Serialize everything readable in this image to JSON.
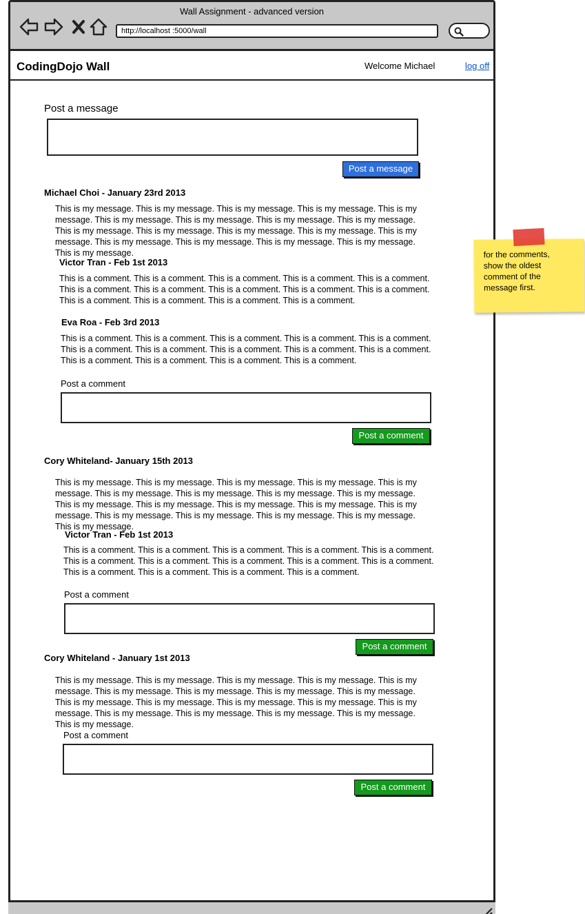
{
  "window": {
    "title": "Wall Assignment - advanced version",
    "url": "http://localhost :5000/wall",
    "icons": [
      "back-icon",
      "forward-icon",
      "close-icon",
      "home-icon",
      "search-icon"
    ]
  },
  "header": {
    "brand": "CodingDojo Wall",
    "welcome": "Welcome Michael",
    "logoff": "log off"
  },
  "post_form": {
    "label": "Post a message",
    "button": "Post a message"
  },
  "messages": [
    {
      "author": "Michael Choi - January 23rd 2013",
      "text": "This is my message. This is my message. This is my message. This is my message. This is my message. This is my message. This is my message. This is my message. This is my message. This is my message. This is my message. This is my message. This is my message. This is my message. This is my message. This is my message. This is my message. This is my message. This is my message.",
      "comments": [
        {
          "author": "Victor Tran - Feb 1st 2013",
          "text": "This is a comment. This is a comment. This is a comment. This is a comment. This is a comment. This is a comment. This is a comment. This is a comment. This is a comment. This is a comment. This is a comment. This is a comment. This is a comment. This is a comment."
        },
        {
          "author": "Eva Roa - Feb 3rd 2013",
          "text": "This is a comment. This is a comment. This is a comment. This is a comment. This is a comment. This is a comment. This is a comment. This is a comment. This is a comment. This is a comment. This is a comment. This is a comment. This is a comment. This is a comment."
        }
      ],
      "comment_label": "Post a comment",
      "comment_button": "Post a comment"
    },
    {
      "author": "Cory Whiteland- January 15th 2013",
      "text": "This is my message. This is my message. This is my message. This is my message. This is my message. This is my message. This is my message. This is my message. This is my message. This is my message. This is my message. This is my message. This is my message. This is my message. This is my message. This is my message. This is my message. This is my message. This is my message.",
      "comments": [
        {
          "author": "Victor Tran - Feb 1st 2013",
          "text": "This is a comment. This is a comment. This is a comment. This is a comment. This is a comment. This is a comment. This is a comment. This is a comment. This is a comment. This is a comment. This is a comment. This is a comment. This is a comment. This is a comment."
        }
      ],
      "comment_label": "Post a comment",
      "comment_button": "Post a comment"
    },
    {
      "author": "Cory Whiteland - January 1st 2013",
      "text": "This is my message. This is my message. This is my message. This is my message. This is my message. This is my message. This is my message. This is my message. This is my message. This is my message. This is my message. This is my message. This is my message. This is my message. This is my message. This is my message. This is my message. This is my message. This is my message.",
      "comments": [],
      "comment_label": "Post a comment",
      "comment_button": "Post a comment"
    }
  ],
  "sticky_note": {
    "text": "for the comments, show the oldest comment of the message first."
  },
  "colors": {
    "primary_button": "#2e6fdb",
    "comment_button": "#149a1e",
    "sticky": "#ffe960",
    "tape": "#e23b35",
    "link": "#0b55c4"
  }
}
